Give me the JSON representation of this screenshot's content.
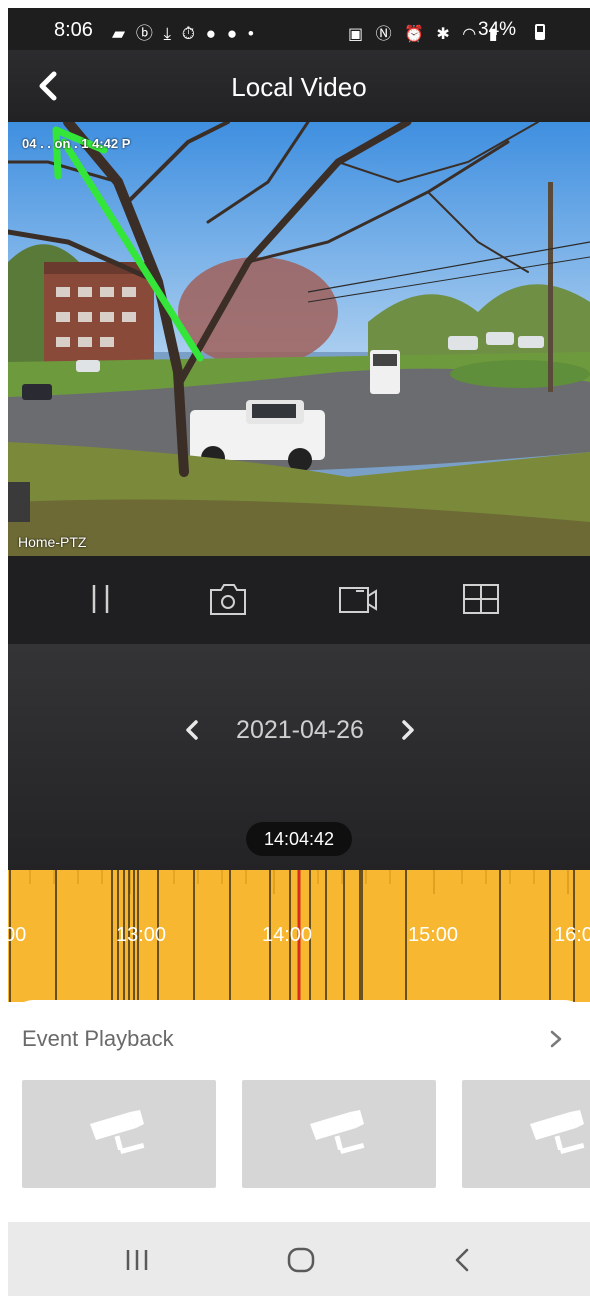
{
  "status_bar": {
    "time": "8:06",
    "battery": "34%",
    "left_icons": [
      "message-icon",
      "b-app-icon",
      "download-icon",
      "stopwatch-icon",
      "app-icon",
      "app-icon",
      "dot-icon"
    ],
    "right_icons": [
      "nfc-lock-icon",
      "nfc-icon",
      "alarm-icon",
      "bluetooth-icon",
      "wifi-icon",
      "signal-icon",
      "battery-icon"
    ]
  },
  "header": {
    "title": "Local Video",
    "back_icon": "chevron-left-icon"
  },
  "video": {
    "osd_text": "04 . . on . 1 4:42 P",
    "camera_name": "Home-PTZ",
    "annotation_arrow_color": "#35e63a"
  },
  "controls": {
    "items": [
      "pause-icon",
      "snapshot-icon",
      "record-icon",
      "grid-view-icon"
    ]
  },
  "playback": {
    "date": "2021-04-26",
    "current_time": "14:04:42"
  },
  "timeline": {
    "labels": [
      "00",
      "13:00",
      "14:00",
      "15:00",
      "16:0"
    ],
    "fill_color": "#f7b731",
    "cursor_color": "#d62d20"
  },
  "events": {
    "title": "Event Playback",
    "thumbnails": [
      "camera-placeholder-icon",
      "camera-placeholder-icon",
      "camera-placeholder-icon"
    ]
  },
  "nav_bar": {
    "items": [
      "recents-icon",
      "home-icon",
      "back-icon"
    ]
  }
}
